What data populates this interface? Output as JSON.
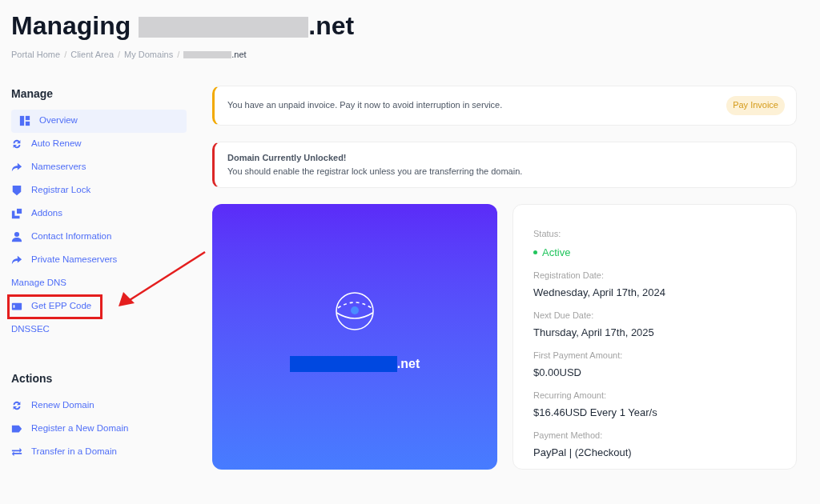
{
  "header": {
    "title_start": "Managing",
    "title_end": ".net"
  },
  "breadcrumb": [
    {
      "label": "Portal Home",
      "redacted": false
    },
    {
      "separator": "/",
      "label": "Client Area",
      "redacted": false
    },
    {
      "separator": "/",
      "label": "My Domains",
      "redacted": false
    },
    {
      "separator": "/",
      "label": ".net",
      "redacted": true
    }
  ],
  "sidebar": {
    "sections": [
      {
        "title": "Manage",
        "items": [
          {
            "label": "Overview",
            "kind": "icon-link",
            "selected": true,
            "annotated": false
          },
          {
            "label": "Auto Renew",
            "kind": "icon-link",
            "selected": false,
            "annotated": false
          },
          {
            "label": "Nameservers",
            "kind": "icon-link",
            "selected": false,
            "annotated": false
          },
          {
            "label": "Registrar Lock",
            "kind": "icon-link",
            "selected": false,
            "annotated": false
          },
          {
            "label": "Addons",
            "kind": "icon-link",
            "selected": false,
            "annotated": false
          },
          {
            "label": "Contact Information",
            "kind": "icon-link",
            "selected": false,
            "annotated": false
          },
          {
            "label": "Private Nameservers",
            "kind": "icon-link",
            "selected": false,
            "annotated": false
          },
          {
            "label": "Manage DNS",
            "kind": "plain-link",
            "selected": false,
            "annotated": false
          },
          {
            "label": "Get EPP Code",
            "kind": "icon-link",
            "selected": false,
            "annotated": true
          },
          {
            "label": "DNSSEC",
            "kind": "plain-link",
            "selected": false,
            "annotated": false
          }
        ]
      },
      {
        "title": "Actions",
        "items": [
          {
            "label": "Renew Domain",
            "kind": "icon-link",
            "selected": false,
            "annotated": false
          },
          {
            "label": "Register a New Domain",
            "kind": "icon-link",
            "selected": false,
            "annotated": false
          },
          {
            "label": "Transfer in a Domain",
            "kind": "icon-link",
            "selected": false,
            "annotated": false
          }
        ]
      }
    ]
  },
  "alerts": [
    {
      "kind": "warning",
      "message": "You have an unpaid invoice. Pay it now to avoid interruption in service.",
      "button": "Pay Invoice"
    },
    {
      "kind": "danger",
      "title": "Domain Currently Unlocked!",
      "message": "You should enable the registrar lock unless you are transferring the domain."
    }
  ],
  "domain_card": {
    "domain_end": ".net"
  },
  "details": [
    {
      "label": "Status:",
      "value": "Active",
      "kind": "status",
      "color": "#22c55e"
    },
    {
      "label": "Registration Date:",
      "value": "Wednesday, April 17th, 2024",
      "kind": "text"
    },
    {
      "label": "Next Due Date:",
      "value": "Thursday, April 17th, 2025",
      "kind": "text"
    },
    {
      "label": "First Payment Amount:",
      "value": "$0.00USD",
      "kind": "text"
    },
    {
      "label": "Recurring Amount:",
      "value": "$16.46USD Every 1 Year/s",
      "kind": "text"
    },
    {
      "label": "Payment Method:",
      "value": "PayPal | (2Checkout)",
      "kind": "text"
    }
  ]
}
